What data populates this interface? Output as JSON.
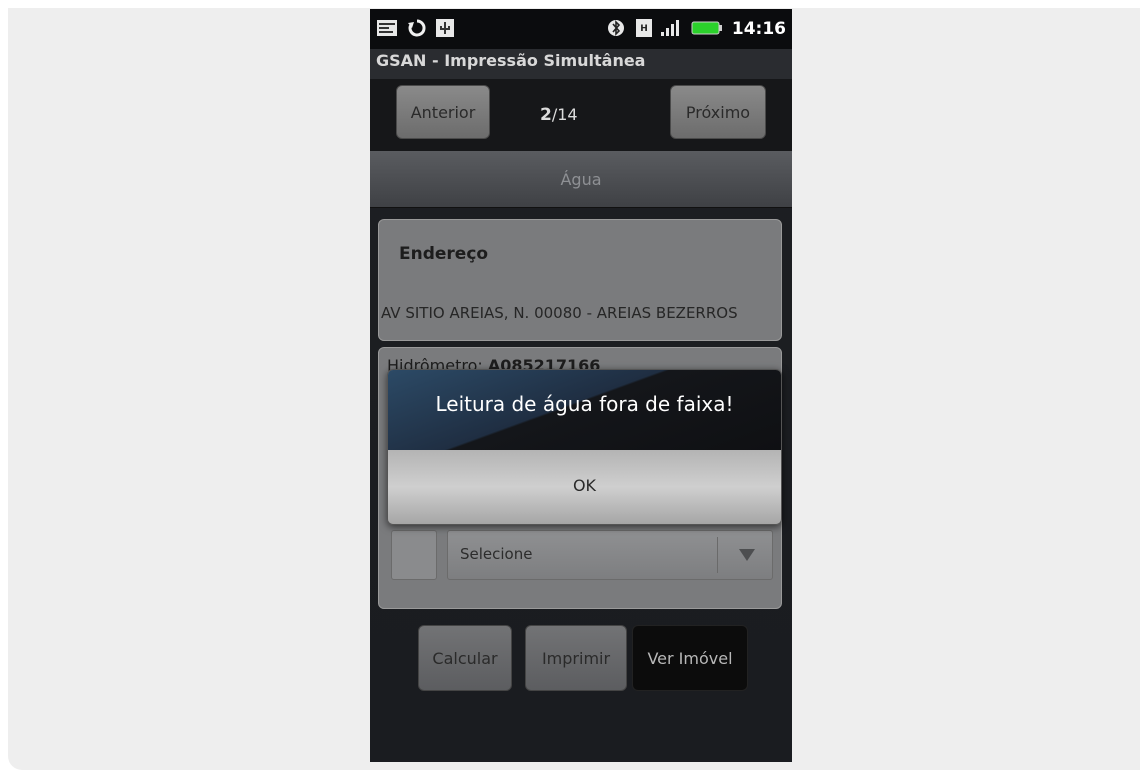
{
  "status_bar": {
    "time": "14:16",
    "icons": [
      "notification-icon",
      "sync-icon",
      "usb-icon",
      "bluetooth-icon",
      "sim-icon",
      "signal-icon",
      "battery-icon"
    ]
  },
  "app": {
    "title": "GSAN - Impressão Simultânea"
  },
  "nav": {
    "prev_label": "Anterior",
    "next_label": "Próximo",
    "current": "2",
    "separator": "/",
    "total": "14"
  },
  "section": {
    "header": "Água"
  },
  "address": {
    "title": "Endereço",
    "value": "AV SITIO AREIAS, N. 00080 - AREIAS BEZERROS"
  },
  "meter": {
    "label": "Hidrômetro: ",
    "value": "A085217166"
  },
  "select": {
    "value": "Selecione"
  },
  "actions": {
    "calculate": "Calcular",
    "print": "Imprimir",
    "view_property": "Ver Imóvel"
  },
  "dialog": {
    "message": "Leitura de água fora de faixa!",
    "ok_label": "OK"
  }
}
